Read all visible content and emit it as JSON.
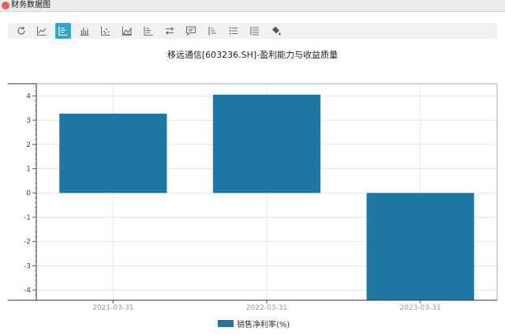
{
  "window": {
    "title": "财务数据图",
    "close_color": "#ee5f5b"
  },
  "toolbar": {
    "tools": [
      {
        "name": "reset-tool",
        "icon": "refresh-icon"
      },
      {
        "name": "line-tool",
        "icon": "line-chart-icon"
      },
      {
        "name": "box-zoom-tool",
        "icon": "box-zoom-icon",
        "active": true
      },
      {
        "name": "bar-tool",
        "icon": "bar-chart-icon"
      },
      {
        "name": "scatter-tool",
        "icon": "scatter-icon"
      },
      {
        "name": "area-tool",
        "icon": "area-chart-icon"
      },
      {
        "name": "stack-tool",
        "icon": "stack-chart-icon"
      },
      {
        "name": "swap-tool",
        "icon": "swap-arrows-icon"
      },
      {
        "name": "data-view-tool",
        "icon": "comment-icon"
      },
      {
        "name": "sort-tool",
        "icon": "sort-icon"
      },
      {
        "name": "list-tool",
        "icon": "list-icon"
      },
      {
        "name": "table-tool",
        "icon": "table-icon"
      },
      {
        "name": "fill-tool",
        "icon": "paint-bucket-icon"
      }
    ],
    "accent": "#2aa7c9"
  },
  "chart_data": {
    "type": "bar",
    "title": "移远通信[603236.SH]-盈利能力与收益质量",
    "categories": [
      "2021-03-31",
      "2022-03-31",
      "2023-03-31"
    ],
    "series": [
      {
        "name": "销售净利率(%)",
        "values": [
          3.27,
          4.05,
          -4.42
        ],
        "color": "#1f77a4"
      }
    ],
    "ylim": [
      -4.42,
      4.5
    ],
    "yticks": [
      -4,
      -3,
      -2,
      -1,
      0,
      1,
      2,
      3,
      4
    ],
    "grid": true,
    "legend": "bottom-center"
  }
}
